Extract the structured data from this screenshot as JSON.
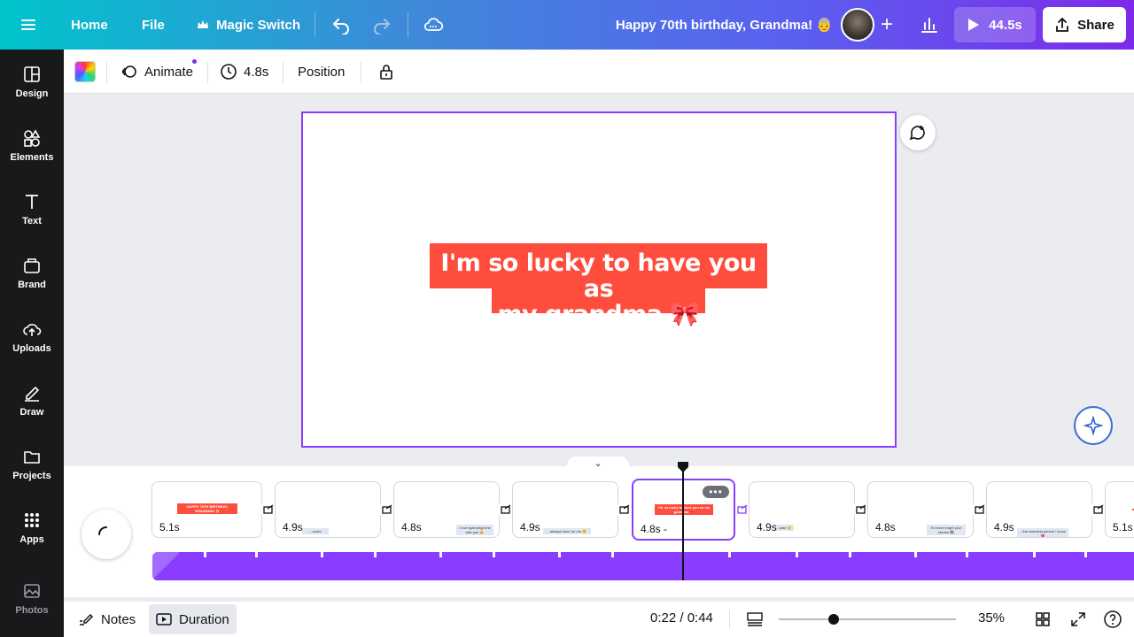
{
  "topbar": {
    "home": "Home",
    "file": "File",
    "magic_switch": "Magic Switch",
    "title": "Happy 70th birthday, Grandma! 👵",
    "play_duration": "44.5s",
    "share": "Share"
  },
  "sidebar": {
    "items": [
      {
        "label": "Design",
        "icon": "design-icon"
      },
      {
        "label": "Elements",
        "icon": "elements-icon"
      },
      {
        "label": "Text",
        "icon": "text-icon"
      },
      {
        "label": "Brand",
        "icon": "brand-icon"
      },
      {
        "label": "Uploads",
        "icon": "uploads-icon"
      },
      {
        "label": "Draw",
        "icon": "draw-icon"
      },
      {
        "label": "Projects",
        "icon": "projects-icon"
      },
      {
        "label": "Apps",
        "icon": "apps-icon"
      },
      {
        "label": "Photos",
        "icon": "photos-icon"
      }
    ]
  },
  "toolbar": {
    "animate": "Animate",
    "duration": "4.8s",
    "position": "Position"
  },
  "canvas": {
    "text_line1": "I'm so lucky to have you as",
    "text_line2": "my grandma 🎀"
  },
  "timeline": {
    "clips": [
      {
        "duration": "5.1s",
        "preview": "HAPPY 70TH BIRTHDAY, GRANDMA! 👵"
      },
      {
        "duration": "4.9s",
        "preview": "...could"
      },
      {
        "duration": "4.8s",
        "preview": "I love spending time with you 😊"
      },
      {
        "duration": "4.9s",
        "preview": "...always there for me 🤗"
      },
      {
        "duration": "4.8s -",
        "preview": "I'm so lucky to have you as my grandma 🎀"
      },
      {
        "duration": "4.9s",
        "preview": "...wise 🙂"
      },
      {
        "duration": "4.8s",
        "preview": "I'll never forget your stories 📚"
      },
      {
        "duration": "4.9s",
        "preview": "...the sweetest person I know 💗"
      },
      {
        "duration": "5.1s",
        "preview": ""
      }
    ]
  },
  "bottombar": {
    "notes": "Notes",
    "duration": "Duration",
    "time": "0:22 / 0:44",
    "zoom": "35%"
  },
  "colors": {
    "accent": "#8b3dff",
    "text_bg": "#ff4d3d",
    "sidebar_bg": "#18191b"
  }
}
